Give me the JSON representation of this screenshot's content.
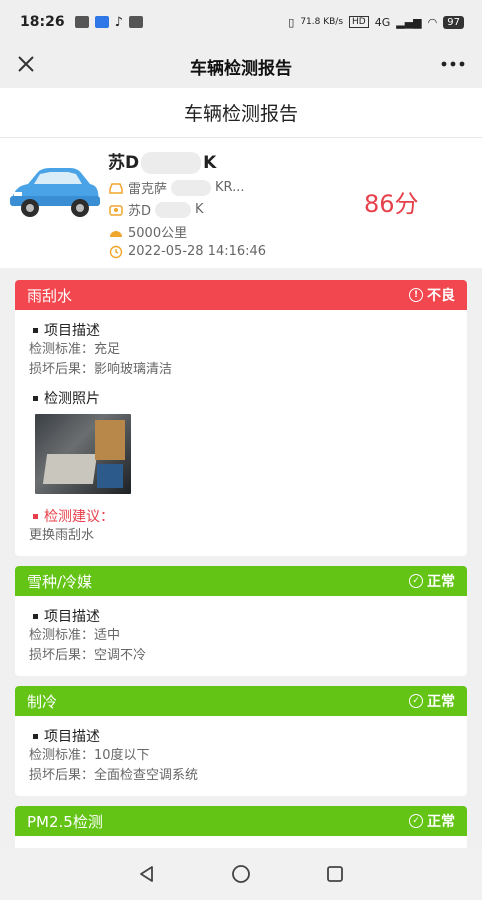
{
  "status_bar": {
    "time": "18:26",
    "speed": "71.8 KB/s",
    "network": "4G",
    "battery": "97"
  },
  "title_bar": {
    "title": "车辆检测报告"
  },
  "page": {
    "header": "车辆检测报告"
  },
  "vehicle": {
    "plate": "苏D",
    "plate_suffix": "K",
    "model": "雷克萨",
    "model_suffix": "KR...",
    "plate2": "苏D",
    "plate2_suffix": "K",
    "mileage": "5000公里",
    "datetime": "2022-05-28 14:16:46",
    "score": "86分"
  },
  "cards": [
    {
      "name": "雨刮水",
      "status": "不良",
      "status_type": "bad",
      "desc_title": "项目描述",
      "standard": "检测标准：充足",
      "consequence": "损坏后果：影响玻璃清洁",
      "photo_title": "检测照片",
      "advice_title": "检测建议：",
      "advice": "更换雨刮水"
    },
    {
      "name": "雪种/冷媒",
      "status": "正常",
      "status_type": "ok",
      "desc_title": "项目描述",
      "standard": "检测标准：适中",
      "consequence": "损坏后果：空调不冷"
    },
    {
      "name": "制冷",
      "status": "正常",
      "status_type": "ok",
      "desc_title": "项目描述",
      "standard": "检测标准：10度以下",
      "consequence": "损坏后果：全面检查空调系统"
    },
    {
      "name": "PM2.5检测",
      "status": "正常",
      "status_type": "ok"
    }
  ],
  "colors": {
    "bad": "#f3474f",
    "ok": "#63c415",
    "score": "#e7404b"
  },
  "icons": {
    "close": "close-icon",
    "more": "more-icon",
    "car": "car-icon",
    "info": "exclamation-circle-icon",
    "check": "check-circle-icon",
    "back": "back-triangle-icon",
    "home": "home-circle-icon",
    "recent": "recent-square-icon"
  }
}
